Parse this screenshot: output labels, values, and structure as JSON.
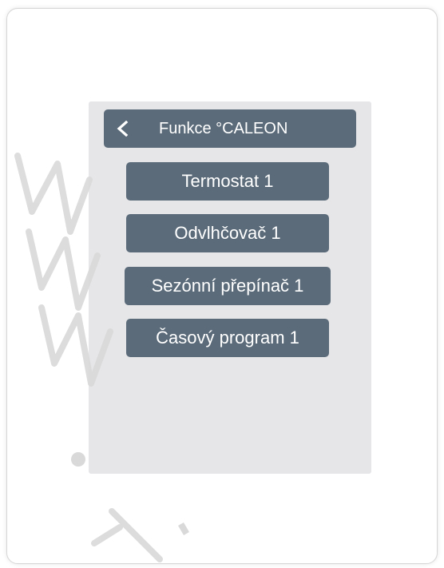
{
  "header": {
    "title": "Funkce °CALEON",
    "back_icon": "chevron-left-icon"
  },
  "menu": {
    "items": [
      {
        "label": "Termostat 1"
      },
      {
        "label": "Odvlhčovač 1"
      },
      {
        "label": "Sezónní přepínač 1"
      },
      {
        "label": "Časový program 1"
      }
    ]
  },
  "colors": {
    "button_bg": "#5b6b79",
    "screen_bg": "#e6e6e8",
    "text": "#ffffff"
  }
}
